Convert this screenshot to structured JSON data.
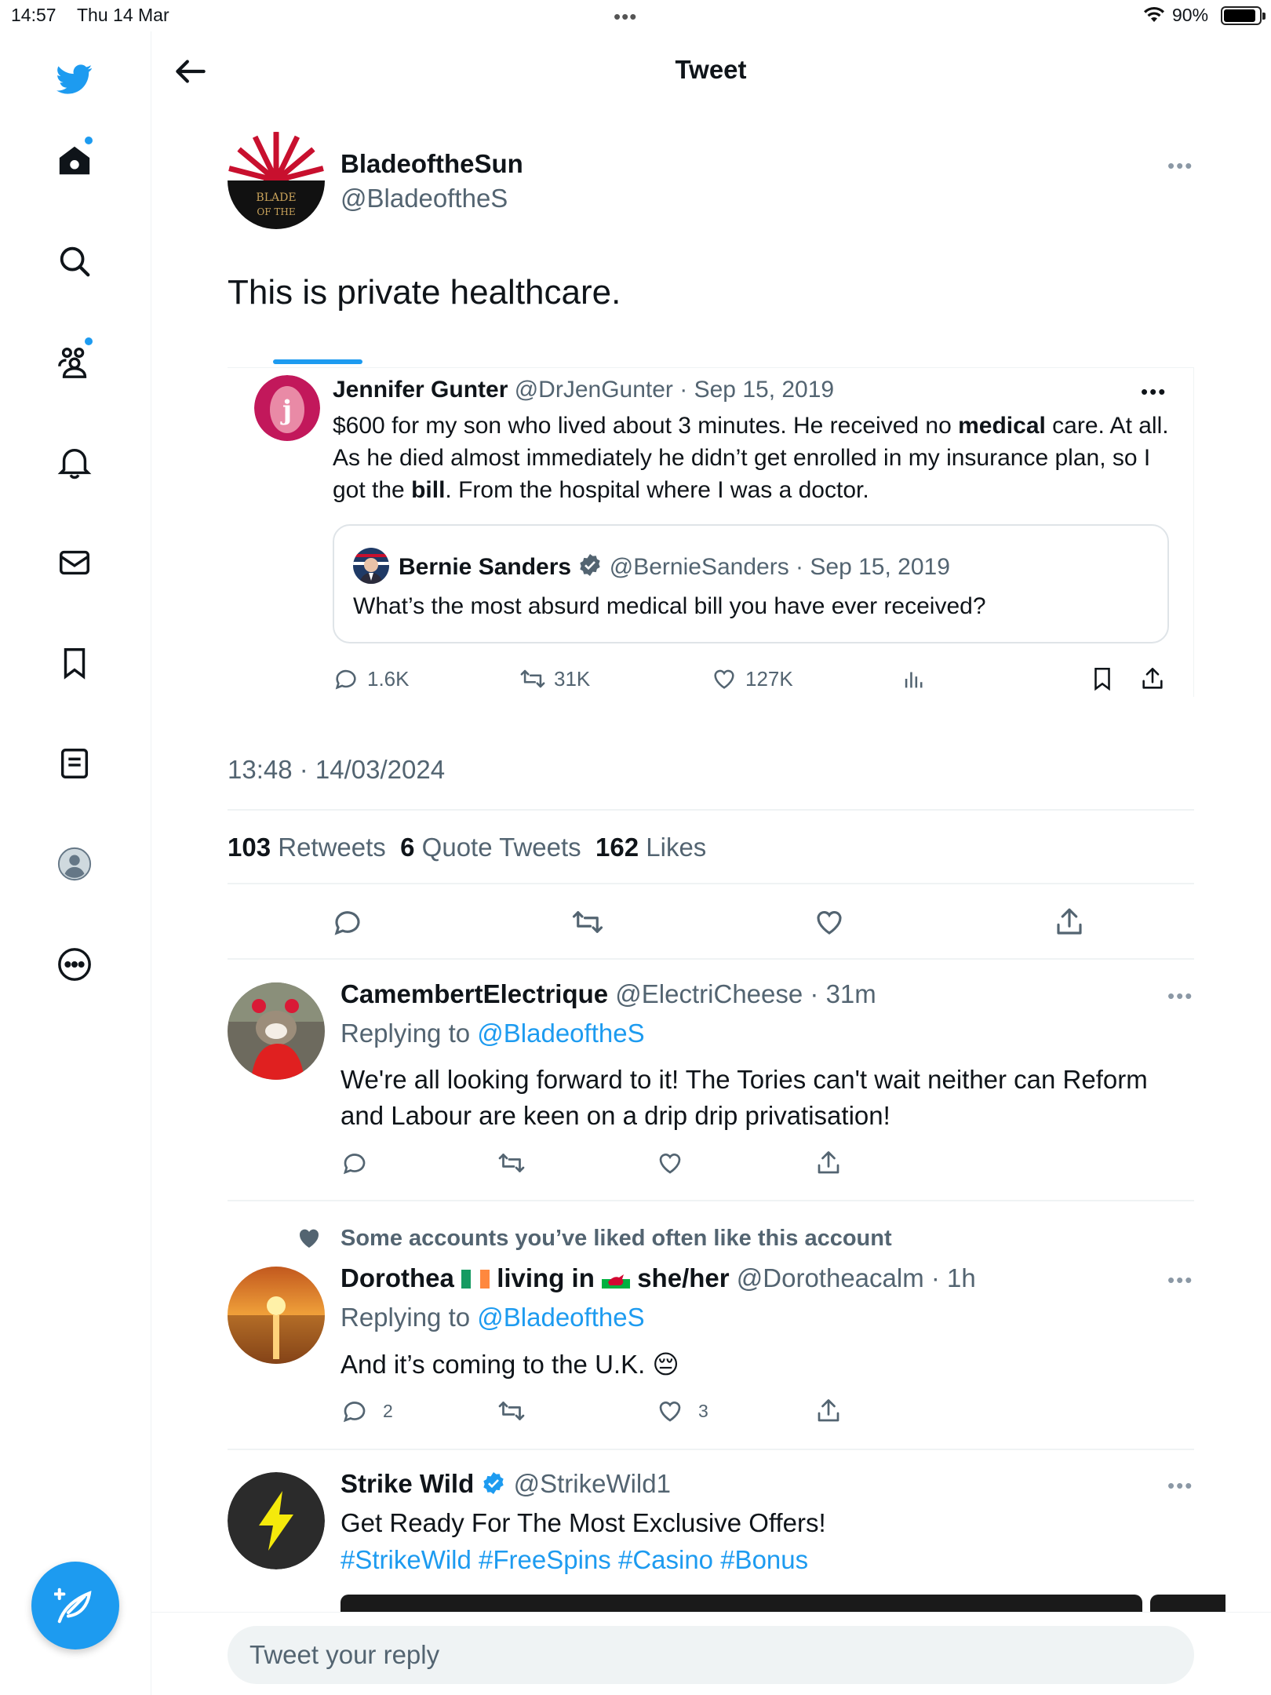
{
  "status_bar": {
    "time": "14:57",
    "date": "Thu 14 Mar",
    "dots": "•••",
    "battery_pct": "90%"
  },
  "header": {
    "title": "Tweet"
  },
  "main_tweet": {
    "name": "BladeoftheSun",
    "handle": "@BladeoftheS",
    "text": "This is private healthcare.",
    "avatar_text_1": "BLADE",
    "avatar_text_2": "OF THE",
    "timestamp": "13:48 · 14/03/2024",
    "stats": {
      "retweets_count": "103",
      "retweets_label": "Retweets",
      "quotes_count": "6",
      "quotes_label": "Quote Tweets",
      "likes_count": "162",
      "likes_label": "Likes"
    }
  },
  "quoted_tweet": {
    "name": "Jennifer Gunter",
    "handle": "@DrJenGunter",
    "date": "Sep 15, 2019",
    "text_1": "$600 for my son who lived about 3 minutes. He received no ",
    "text_bold_1": "medical",
    "text_2": " care. At all. As he died almost immediately he didn’t get enrolled in my insurance plan, so I got the ",
    "text_bold_2": "bill",
    "text_3": ".  From the hospital where I was a doctor.",
    "replies": "1.6K",
    "retweets": "31K",
    "likes": "127K"
  },
  "inner_quote": {
    "name": "Bernie Sanders",
    "handle": "@BernieSanders",
    "date": "Sep 15, 2019",
    "text": "What’s the most absurd medical bill you have ever received?"
  },
  "replies": [
    {
      "name": "CamembertElectrique",
      "handle": "@ElectriCheese",
      "time": "31m",
      "replying_label": "Replying to",
      "replying_to": "@BladeoftheS",
      "text": "We're all looking forward to it! The Tories can't wait neither can Reform and Labour are keen on a drip drip privatisation!",
      "reply_count": "",
      "like_count": ""
    },
    {
      "context": "Some accounts you’ve liked often like this account",
      "name_1": "Dorothea",
      "name_2": "living in",
      "name_3": "she/her",
      "handle": "@Dorotheacalm",
      "time": "1h",
      "replying_label": "Replying to",
      "replying_to": "@BladeoftheS",
      "text": "And it’s coming to the U.K.",
      "emoji": "😔",
      "reply_count": "2",
      "like_count": "3"
    }
  ],
  "promoted": {
    "name": "Strike Wild",
    "handle": "@StrikeWild1",
    "text": "Get Ready For The Most Exclusive Offers!",
    "hashtags": "#StrikeWild #FreeSpins #Casino #Bonus"
  },
  "reply_bar": {
    "placeholder": "Tweet your reply"
  },
  "colors": {
    "accent": "#1d9bf0",
    "muted": "#536471",
    "divider": "#eff3f4"
  }
}
